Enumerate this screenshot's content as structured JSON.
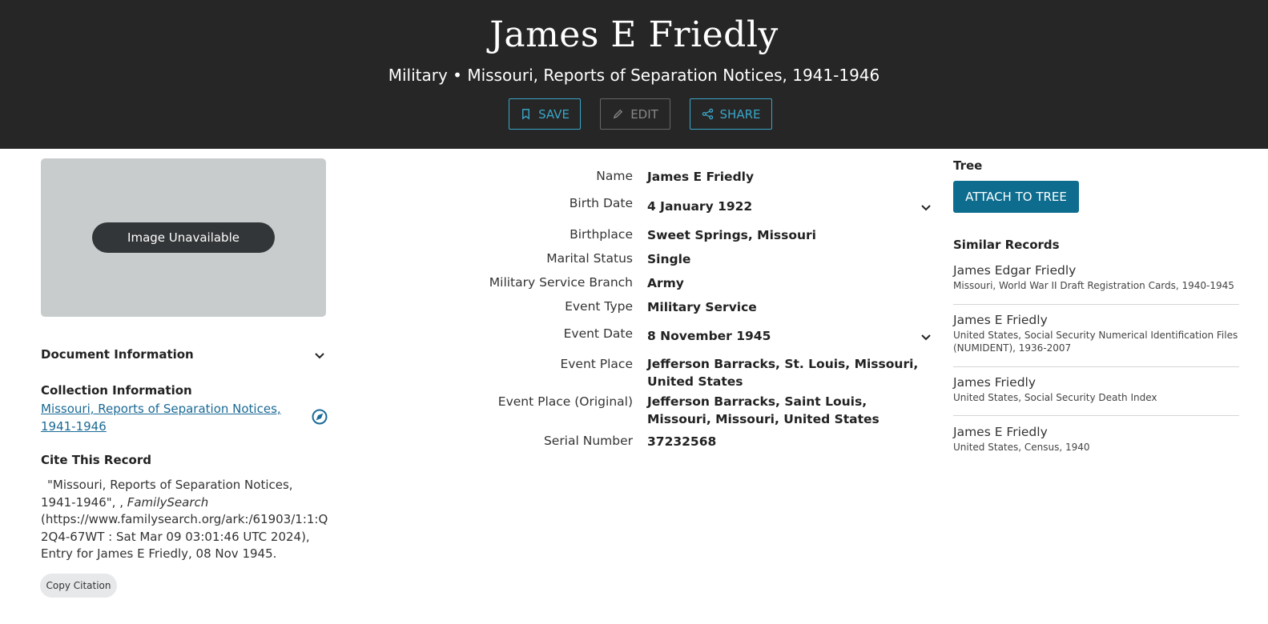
{
  "header": {
    "title": "James E Friedly",
    "subtitle": "Military • Missouri, Reports of Separation Notices, 1941-1946",
    "save_label": "SAVE",
    "edit_label": "EDIT",
    "share_label": "SHARE"
  },
  "image": {
    "unavailable_label": "Image Unavailable"
  },
  "document_info": {
    "label": "Document Information"
  },
  "collection": {
    "heading": "Collection Information",
    "link_line1": "Missouri, Reports of Separation Notices,",
    "link_line2": "1941-1946"
  },
  "cite": {
    "heading": "Cite This Record",
    "line1": "\"Missouri, Reports of Separation Notices,",
    "line2": "1941-1946\", , ",
    "source": "FamilySearch",
    "line3": "(https://www.familysearch.org/ark:/61903/1:1:Q",
    "line4": "2Q4-67WT : Sat Mar 09 03:01:46 UTC 2024),",
    "line5": "Entry for James E Friedly, 08 Nov 1945.",
    "copy_label": "Copy Citation"
  },
  "facts": [
    {
      "label": "Name",
      "value": "James E Friedly"
    },
    {
      "label": "Birth Date",
      "value": "4 January 1922"
    },
    {
      "label": "Birthplace",
      "value": "Sweet Springs, Missouri"
    },
    {
      "label": "Marital Status",
      "value": "Single"
    },
    {
      "label": "Military Service Branch",
      "value": "Army"
    },
    {
      "label": "Event Type",
      "value": "Military Service"
    },
    {
      "label": "Event Date",
      "value": "8 November 1945"
    },
    {
      "label": "Event Place",
      "value": "Jefferson Barracks, St. Louis, Missouri, United States"
    },
    {
      "label": "Event Place (Original)",
      "value": "Jefferson Barracks, Saint Louis, Missouri, Missouri, United States"
    },
    {
      "label": "Serial Number",
      "value": "37232568"
    }
  ],
  "tree": {
    "heading": "Tree",
    "attach_label": "ATTACH TO TREE"
  },
  "similar": {
    "heading": "Similar Records",
    "items": [
      {
        "name": "James Edgar Friedly",
        "collection": "Missouri, World War II Draft Registration Cards, 1940-1945"
      },
      {
        "name": "James E Friedly",
        "collection": "United States, Social Security Numerical Identification Files (NUMIDENT), 1936-2007"
      },
      {
        "name": "James Friedly",
        "collection": "United States, Social Security Death Index"
      },
      {
        "name": "James E Friedly",
        "collection": "United States, Census, 1940"
      }
    ]
  },
  "colors": {
    "header_bg": "#262626",
    "accent": "#3aa6c9",
    "link": "#1a6a96",
    "attach_button": "#0e6d8f"
  }
}
